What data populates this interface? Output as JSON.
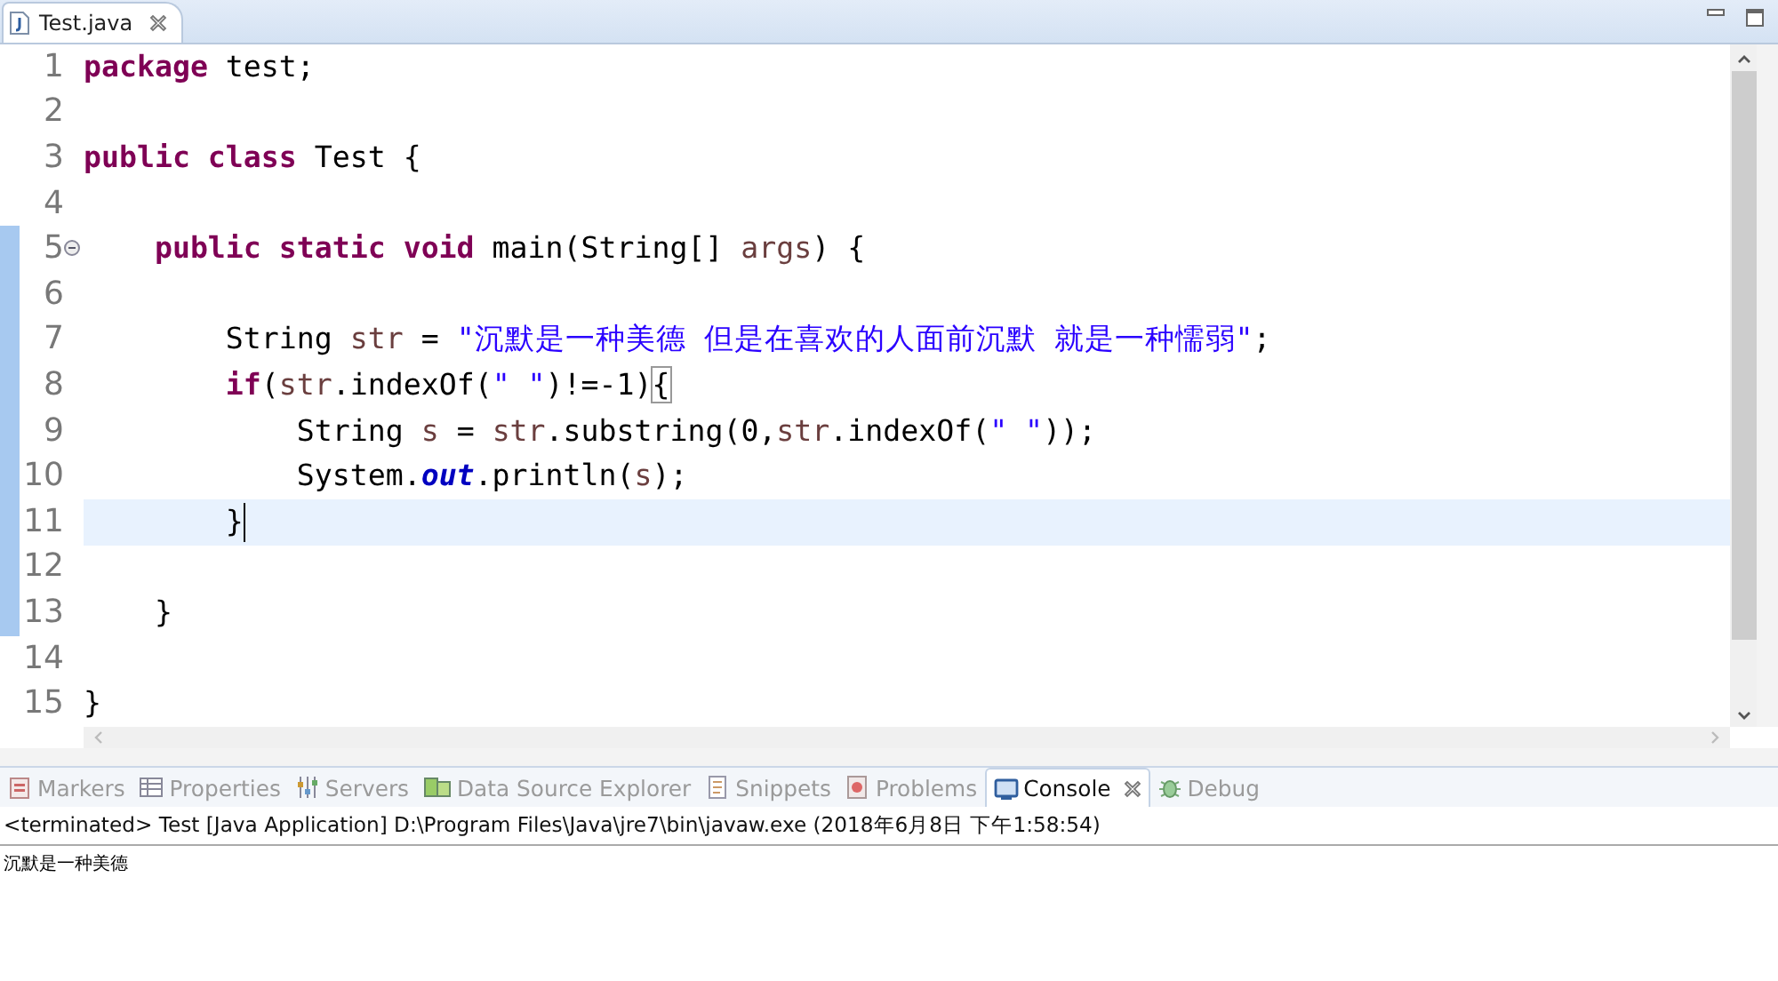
{
  "editor_tab": {
    "label": "Test.java"
  },
  "code": {
    "lines": [
      {
        "number": "1",
        "current": false,
        "in_range": false,
        "fold": false,
        "cursor": false,
        "tokens": [
          {
            "kind": "kw",
            "text": "package"
          },
          {
            "kind": "plain",
            "text": " test;"
          }
        ]
      },
      {
        "number": "2",
        "current": false,
        "in_range": false,
        "fold": false,
        "cursor": false
      },
      {
        "number": "3",
        "current": false,
        "in_range": false,
        "fold": false,
        "cursor": false,
        "tokens": [
          {
            "kind": "kw",
            "text": "public class"
          },
          {
            "kind": "plain",
            "text": " Test {"
          }
        ]
      },
      {
        "number": "4",
        "current": false,
        "in_range": false,
        "fold": false,
        "cursor": false
      },
      {
        "number": "5",
        "current": false,
        "in_range": true,
        "fold": true,
        "cursor": false,
        "tokens": [
          {
            "kind": "kw",
            "text": "    public static void"
          },
          {
            "kind": "plain",
            "text": " main(String[] "
          },
          {
            "kind": "var",
            "text": "args"
          },
          {
            "kind": "plain",
            "text": ") {"
          }
        ]
      },
      {
        "number": "6",
        "current": false,
        "in_range": true,
        "fold": false,
        "cursor": false
      },
      {
        "number": "7",
        "current": false,
        "in_range": true,
        "fold": false,
        "cursor": false,
        "tokens": [
          {
            "kind": "plain",
            "text": "        String "
          },
          {
            "kind": "var",
            "text": "str"
          },
          {
            "kind": "plain",
            "text": " = "
          },
          {
            "kind": "str",
            "text": "\"沉默是一种美德 但是在喜欢的人面前沉默 就是一种懦弱\""
          },
          {
            "kind": "plain",
            "text": ";"
          }
        ]
      },
      {
        "number": "8",
        "current": false,
        "in_range": true,
        "fold": false,
        "cursor": false,
        "tokens": [
          {
            "kind": "kw",
            "text": "        if"
          },
          {
            "kind": "plain",
            "text": "("
          },
          {
            "kind": "var",
            "text": "str"
          },
          {
            "kind": "plain",
            "text": ".indexOf("
          },
          {
            "kind": "str",
            "text": "\" \""
          },
          {
            "kind": "plain",
            "text": ")!=-1)"
          },
          {
            "kind": "bracket_match",
            "text": "{"
          }
        ]
      },
      {
        "number": "9",
        "current": false,
        "in_range": true,
        "fold": false,
        "cursor": false,
        "tokens": [
          {
            "kind": "plain",
            "text": "            String "
          },
          {
            "kind": "var",
            "text": "s"
          },
          {
            "kind": "plain",
            "text": " = "
          },
          {
            "kind": "var",
            "text": "str"
          },
          {
            "kind": "plain",
            "text": ".substring(0,"
          },
          {
            "kind": "var",
            "text": "str"
          },
          {
            "kind": "plain",
            "text": ".indexOf("
          },
          {
            "kind": "str",
            "text": "\" \""
          },
          {
            "kind": "plain",
            "text": "));"
          }
        ]
      },
      {
        "number": "10",
        "current": false,
        "in_range": true,
        "fold": false,
        "cursor": false,
        "tokens": [
          {
            "kind": "plain",
            "text": "            System."
          },
          {
            "kind": "static_field",
            "text": "out"
          },
          {
            "kind": "plain",
            "text": ".println("
          },
          {
            "kind": "var",
            "text": "s"
          },
          {
            "kind": "plain",
            "text": ");"
          }
        ]
      },
      {
        "number": "11",
        "current": true,
        "in_range": true,
        "fold": false,
        "cursor": true,
        "tokens": [
          {
            "kind": "plain",
            "text": "        }"
          }
        ]
      },
      {
        "number": "12",
        "current": false,
        "in_range": true,
        "fold": false,
        "cursor": false
      },
      {
        "number": "13",
        "current": false,
        "in_range": true,
        "fold": false,
        "cursor": false,
        "tokens": [
          {
            "kind": "plain",
            "text": "    }"
          }
        ]
      },
      {
        "number": "14",
        "current": false,
        "in_range": false,
        "fold": false,
        "cursor": false
      },
      {
        "number": "15",
        "current": false,
        "in_range": false,
        "fold": false,
        "cursor": false,
        "tokens": [
          {
            "kind": "plain",
            "text": "}"
          }
        ]
      }
    ]
  },
  "panel_tabs": [
    {
      "label": "Markers",
      "selected": false
    },
    {
      "label": "Properties",
      "selected": false
    },
    {
      "label": "Servers",
      "selected": false
    },
    {
      "label": "Data Source Explorer",
      "selected": false
    },
    {
      "label": "Snippets",
      "selected": false
    },
    {
      "label": "Problems",
      "selected": false
    },
    {
      "label": "Console",
      "selected": true
    },
    {
      "label": "Debug",
      "selected": false
    }
  ],
  "console": {
    "header": "<terminated> Test [Java Application] D:\\Program Files\\Java\\jre7\\bin\\javaw.exe (2018年6月8日 下午1:58:54)",
    "output": "沉默是一种美德"
  }
}
